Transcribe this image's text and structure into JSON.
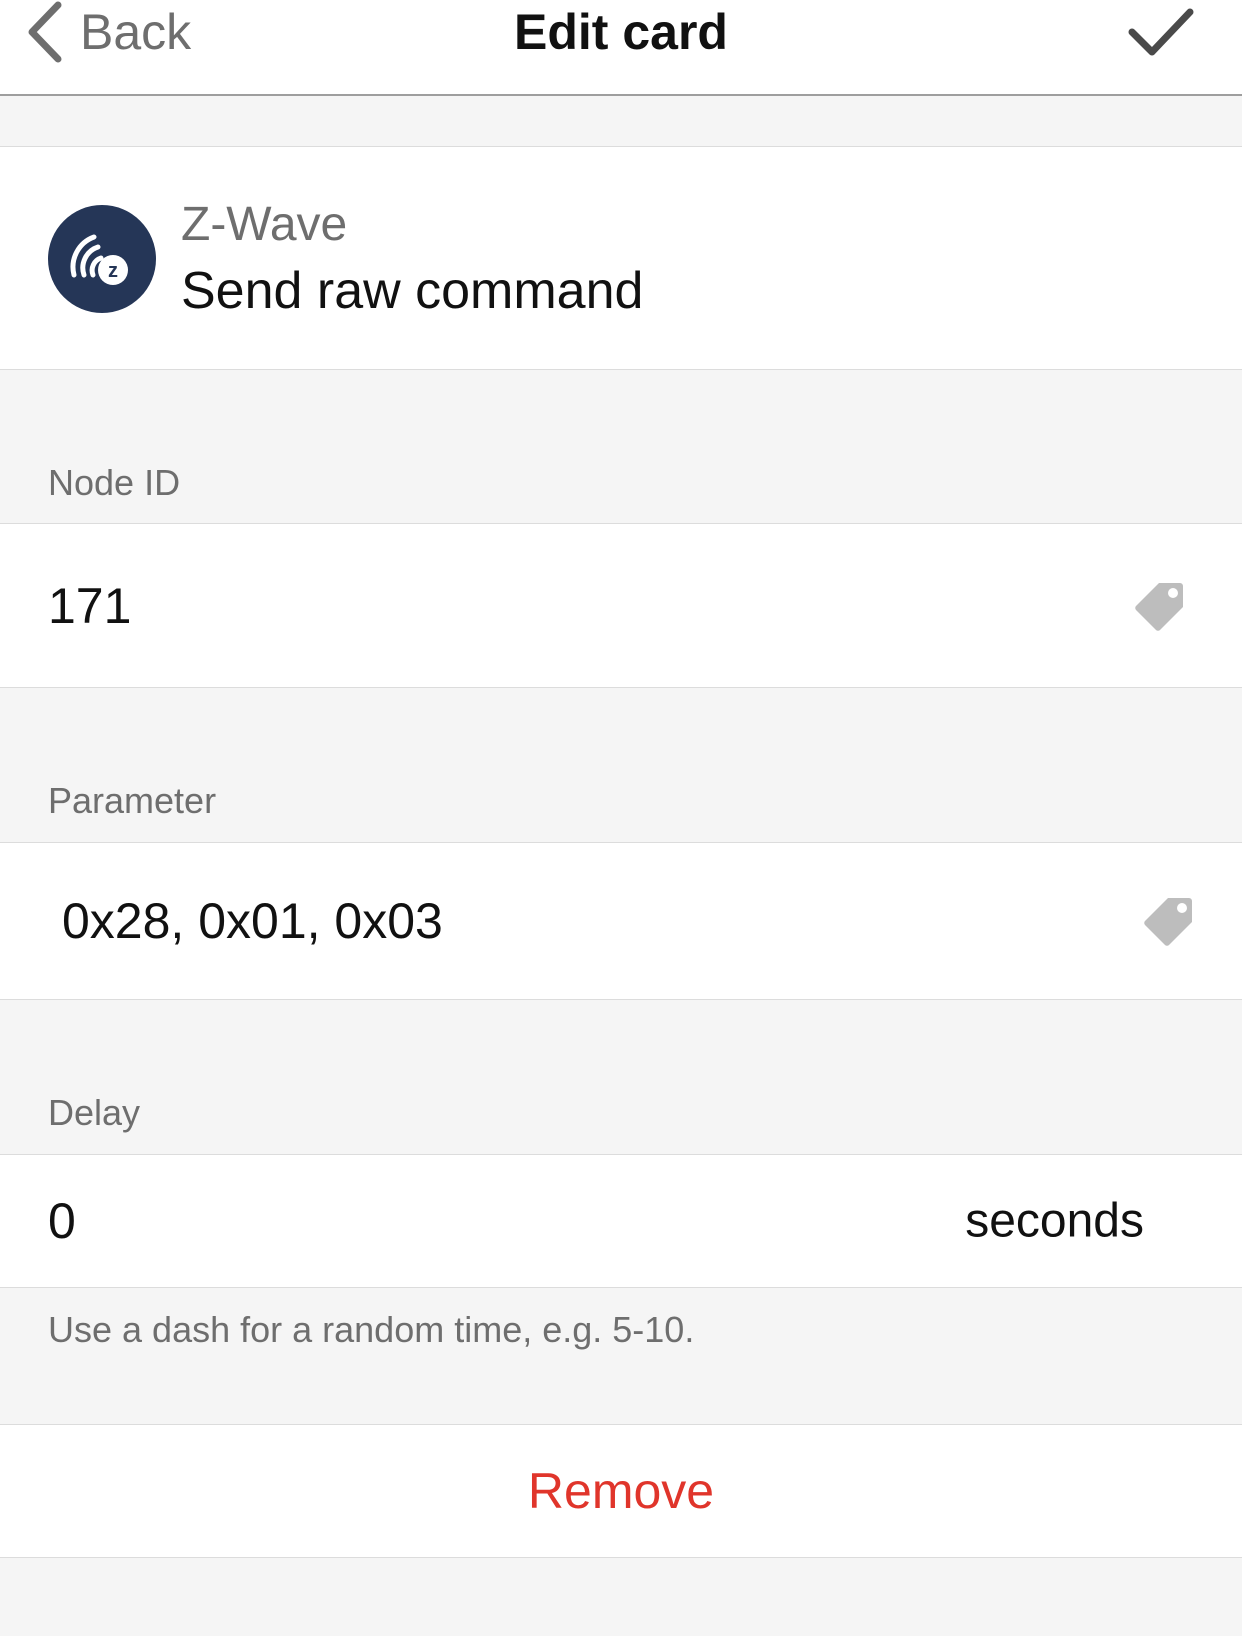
{
  "header": {
    "back_label": "Back",
    "title": "Edit card",
    "back_icon": "chevron-left-icon",
    "done_icon": "checkmark-icon"
  },
  "card": {
    "app_name": "Z-Wave",
    "title": "Send raw command",
    "icon": "zwave-logo-icon",
    "icon_color": "#253657"
  },
  "fields": {
    "node_id": {
      "label": "Node ID",
      "value": "171",
      "icon": "tag-icon"
    },
    "parameter": {
      "label": "Parameter",
      "value": "0x28, 0x01, 0x03",
      "icon": "tag-icon"
    },
    "delay": {
      "label": "Delay",
      "value": "0",
      "unit": "seconds",
      "hint": "Use a dash for a random time, e.g. 5-10."
    }
  },
  "actions": {
    "remove_label": "Remove",
    "remove_color": "#e0352b"
  }
}
